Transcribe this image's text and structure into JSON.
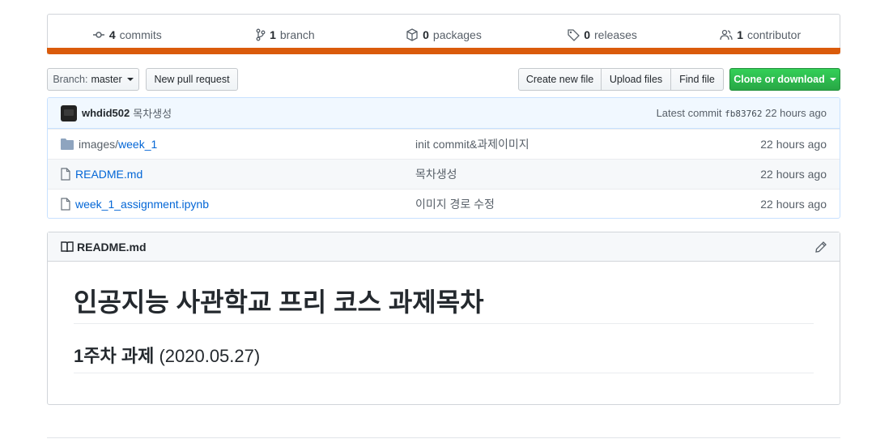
{
  "summary": {
    "commits": {
      "count": "4",
      "label": "commits"
    },
    "branches": {
      "count": "1",
      "label": "branch"
    },
    "packages": {
      "count": "0",
      "label": "packages"
    },
    "releases": {
      "count": "0",
      "label": "releases"
    },
    "contributors": {
      "count": "1",
      "label": "contributor"
    },
    "language_color": "#da5b0b"
  },
  "toolbar": {
    "branch_prefix": "Branch:",
    "branch_name": "master",
    "new_pr": "New pull request",
    "create_file": "Create new file",
    "upload_files": "Upload files",
    "find_file": "Find file",
    "clone": "Clone or download"
  },
  "latest_commit": {
    "author": "whdid502",
    "message": "목차생성",
    "prefix": "Latest commit",
    "sha": "fb83762",
    "age": "22 hours ago"
  },
  "files": [
    {
      "icon": "folder-icon",
      "dir": "images/",
      "name": "week_1",
      "message": "init commit&과제이미지",
      "age": "22 hours ago"
    },
    {
      "icon": "file-icon",
      "dir": "",
      "name": "README.md",
      "message": "목차생성",
      "age": "22 hours ago"
    },
    {
      "icon": "file-icon",
      "dir": "",
      "name": "week_1_assignment.ipynb",
      "message": "이미지 경로 수정",
      "age": "22 hours ago"
    }
  ],
  "readme": {
    "filename": "README.md",
    "h1": "인공지능 사관학교 프리 코스 과제목차",
    "h2_main": "1주차 과제",
    "h2_date": "(2020.05.27)"
  }
}
